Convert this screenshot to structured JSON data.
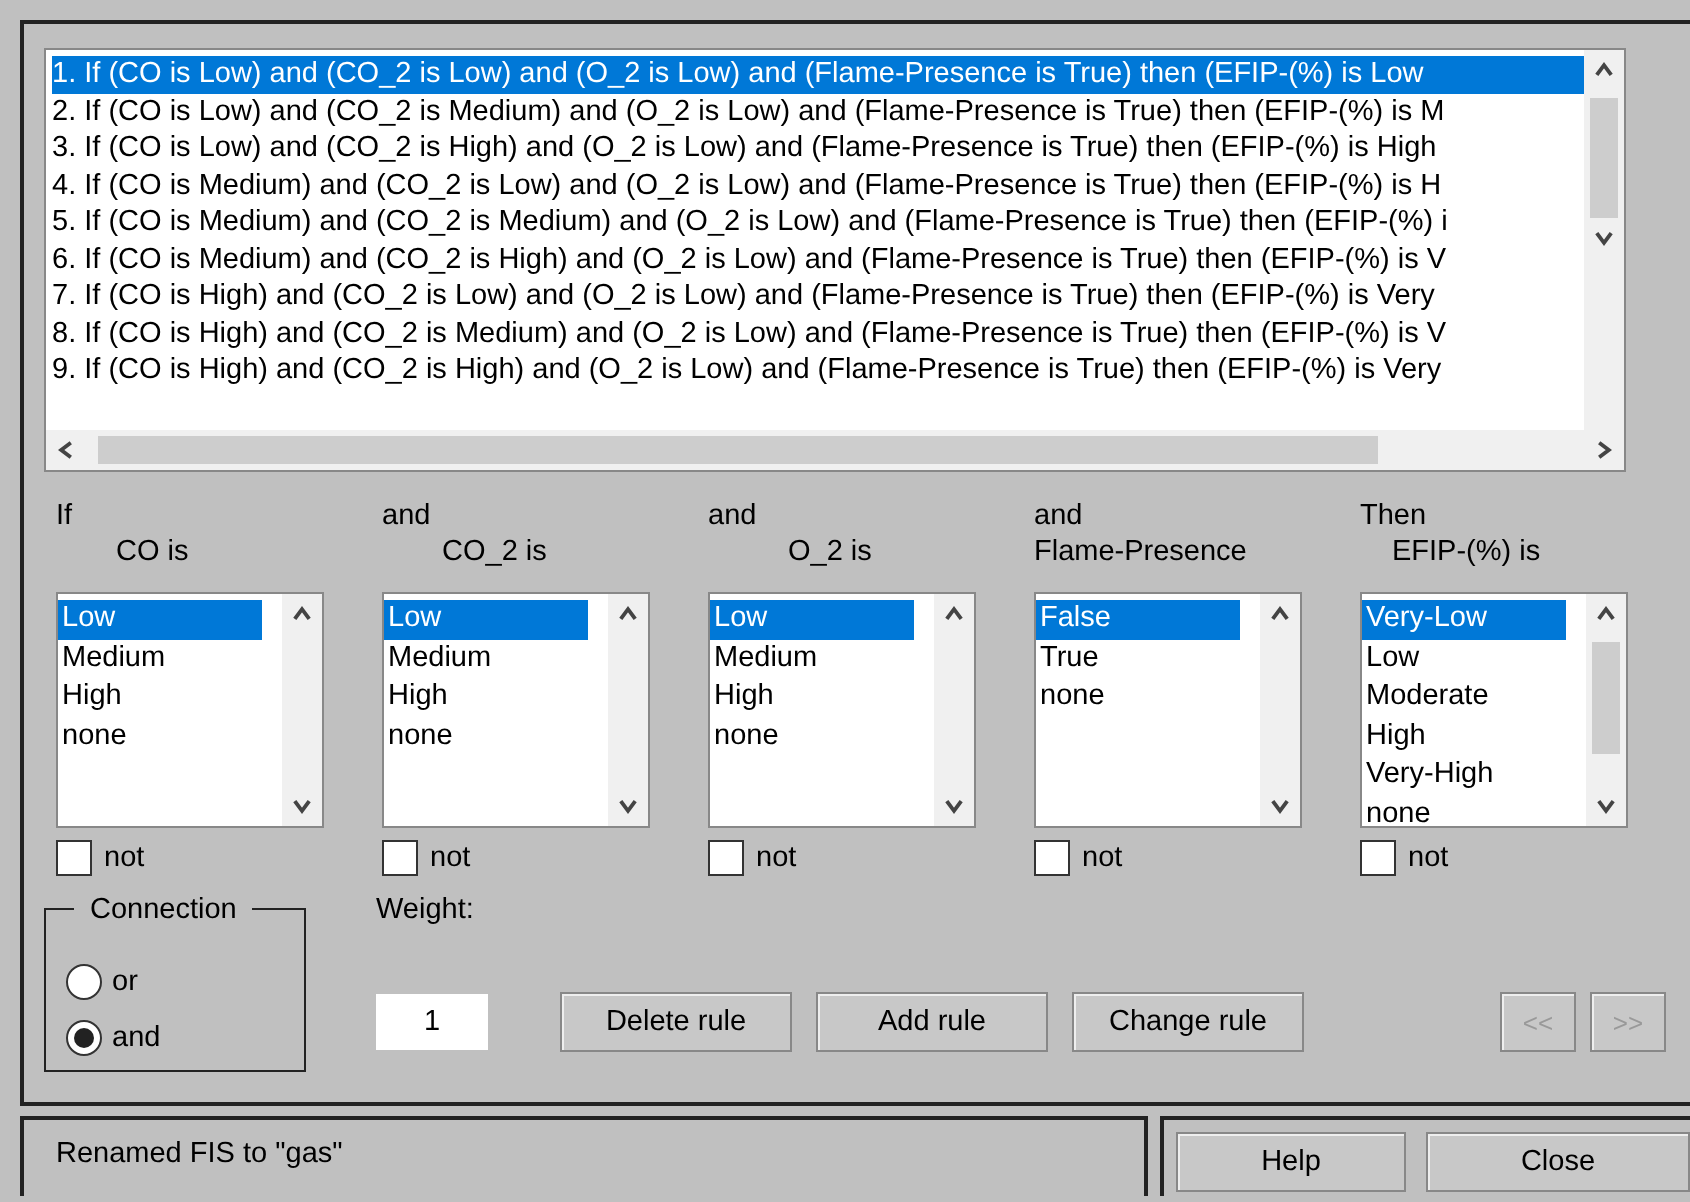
{
  "rules": [
    {
      "text": "1. If (CO is Low) and (CO_2 is Low) and (O_2 is Low) and (Flame-Presence is True) then (EFIP-(%) is Low",
      "selected": true
    },
    {
      "text": "2. If (CO is Low) and (CO_2 is Medium) and (O_2 is Low) and (Flame-Presence is True) then (EFIP-(%) is M",
      "selected": false
    },
    {
      "text": "3. If (CO is Low) and (CO_2 is High) and (O_2 is Low) and (Flame-Presence is True) then (EFIP-(%) is High",
      "selected": false
    },
    {
      "text": "4. If (CO is Medium) and (CO_2 is Low) and (O_2 is Low) and (Flame-Presence is True) then (EFIP-(%) is H",
      "selected": false
    },
    {
      "text": "5. If (CO is Medium) and (CO_2 is Medium) and (O_2 is Low) and (Flame-Presence is True) then (EFIP-(%) i",
      "selected": false
    },
    {
      "text": "6. If (CO is Medium) and (CO_2 is High) and (O_2 is Low) and (Flame-Presence is True) then (EFIP-(%) is V",
      "selected": false
    },
    {
      "text": "7. If (CO is High) and (CO_2 is Low) and (O_2 is Low) and (Flame-Presence is True) then (EFIP-(%) is Very",
      "selected": false
    },
    {
      "text": "8. If (CO is High) and (CO_2 is Medium) and (O_2 is Low) and (Flame-Presence is True) then (EFIP-(%) is V",
      "selected": false
    },
    {
      "text": "9. If (CO is High) and (CO_2 is High) and (O_2 is Low) and (Flame-Presence is True) then (EFIP-(%) is Very",
      "selected": false
    }
  ],
  "columns": [
    {
      "prefix": "If",
      "label": "CO is",
      "options": [
        {
          "label": "Low",
          "selected": true
        },
        {
          "label": "Medium",
          "selected": false
        },
        {
          "label": "High",
          "selected": false
        },
        {
          "label": "none",
          "selected": false
        }
      ],
      "not": {
        "label": "not",
        "checked": false
      }
    },
    {
      "prefix": "and",
      "label": "CO_2 is",
      "options": [
        {
          "label": "Low",
          "selected": true
        },
        {
          "label": "Medium",
          "selected": false
        },
        {
          "label": "High",
          "selected": false
        },
        {
          "label": "none",
          "selected": false
        }
      ],
      "not": {
        "label": "not",
        "checked": false
      }
    },
    {
      "prefix": "and",
      "label": "O_2 is",
      "options": [
        {
          "label": "Low",
          "selected": true
        },
        {
          "label": "Medium",
          "selected": false
        },
        {
          "label": "High",
          "selected": false
        },
        {
          "label": "none",
          "selected": false
        }
      ],
      "not": {
        "label": "not",
        "checked": false
      }
    },
    {
      "prefix": "and",
      "label": "Flame-Presence",
      "options": [
        {
          "label": "False",
          "selected": true
        },
        {
          "label": "True",
          "selected": false
        },
        {
          "label": "none",
          "selected": false
        }
      ],
      "not": {
        "label": "not",
        "checked": false
      }
    },
    {
      "prefix": "Then",
      "label": "EFIP-(%) is",
      "options": [
        {
          "label": "Very-Low",
          "selected": true
        },
        {
          "label": "Low",
          "selected": false
        },
        {
          "label": "Moderate",
          "selected": false
        },
        {
          "label": "High",
          "selected": false
        },
        {
          "label": "Very-High",
          "selected": false
        },
        {
          "label": "none",
          "selected": false
        }
      ],
      "not": {
        "label": "not",
        "checked": false
      }
    }
  ],
  "connection": {
    "title": "Connection",
    "options": [
      {
        "label": "or",
        "selected": false
      },
      {
        "label": "and",
        "selected": true
      }
    ]
  },
  "weight": {
    "label": "Weight:",
    "value": "1"
  },
  "buttons": [
    {
      "label": "Delete rule",
      "disabled": false
    },
    {
      "label": "Add rule",
      "disabled": false
    },
    {
      "label": "Change rule",
      "disabled": false
    }
  ],
  "nav_buttons": [
    {
      "label": "<<",
      "disabled": true
    },
    {
      "label": ">>",
      "disabled": true
    }
  ],
  "status": "Renamed FIS to \"gas\"",
  "footer_buttons": [
    {
      "label": "Help"
    },
    {
      "label": "Close"
    }
  ]
}
